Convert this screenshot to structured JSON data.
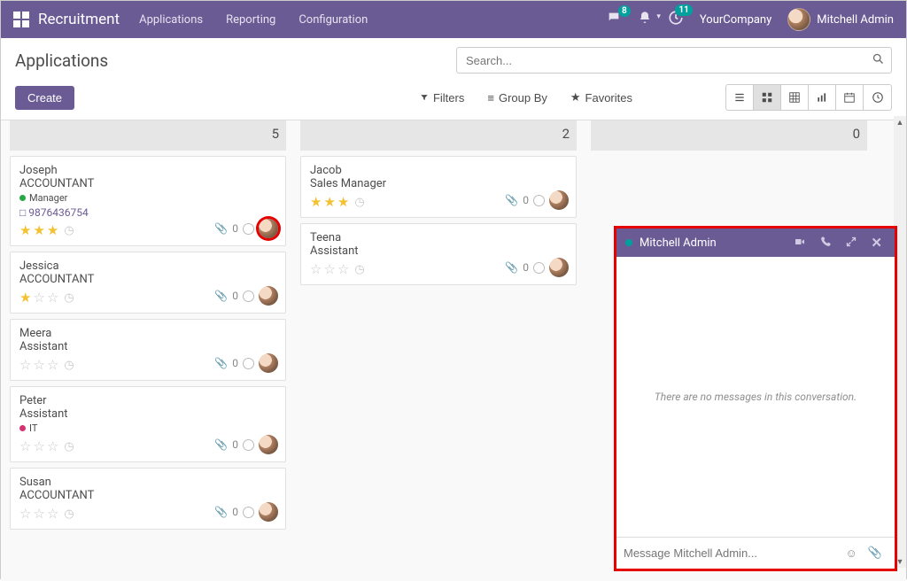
{
  "topbar": {
    "brand": "Recruitment",
    "menu": [
      "Applications",
      "Reporting",
      "Configuration"
    ],
    "messages_badge": "8",
    "activities_badge": "11",
    "company": "YourCompany",
    "user": "Mitchell Admin"
  },
  "page": {
    "title": "Applications",
    "create_label": "Create",
    "search_placeholder": "Search..."
  },
  "filters": {
    "filters_label": "Filters",
    "groupby_label": "Group By",
    "favorites_label": "Favorites"
  },
  "columns": {
    "col1_count": "5",
    "col2_count": "2",
    "col3_count": "0"
  },
  "cards": {
    "joseph": {
      "name": "Joseph",
      "role": "ACCOUNTANT",
      "tag_label": "Manager",
      "tag_color": "#28a745",
      "phone": "9876436754",
      "stars": 3,
      "att": "0"
    },
    "jessica": {
      "name": "Jessica",
      "role": "ACCOUNTANT",
      "stars": 1,
      "att": "0"
    },
    "meera": {
      "name": "Meera",
      "role": "Assistant",
      "stars": 0,
      "att": "0"
    },
    "peter": {
      "name": "Peter",
      "role": "Assistant",
      "tag_label": "IT",
      "tag_color": "#d53273",
      "stars": 0,
      "att": "0"
    },
    "susan": {
      "name": "Susan",
      "role": "ACCOUNTANT",
      "stars": 0,
      "att": "0"
    },
    "jacob": {
      "name": "Jacob",
      "role": "Sales Manager",
      "stars": 3,
      "att": "0"
    },
    "teena": {
      "name": "Teena",
      "role": "Assistant",
      "stars": 0,
      "att": "0"
    }
  },
  "chat": {
    "title": "Mitchell Admin",
    "empty_text": "There are no messages in this conversation.",
    "input_placeholder": "Message Mitchell Admin..."
  }
}
